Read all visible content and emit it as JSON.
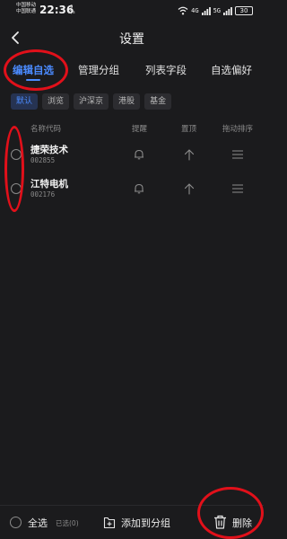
{
  "status_bar": {
    "carrier_1": "中国移动",
    "carrier_2": "中国联通",
    "time": "22:36",
    "net_speed_value": "5",
    "net_speed_unit": "K/s",
    "signal_1": "4G",
    "signal_2": "5G",
    "battery": "30"
  },
  "header": {
    "title": "设置"
  },
  "tabs": [
    {
      "label": "编辑自选",
      "active": true
    },
    {
      "label": "管理分组",
      "active": false
    },
    {
      "label": "列表字段",
      "active": false
    },
    {
      "label": "自选偏好",
      "active": false
    }
  ],
  "filters": [
    {
      "label": "默认",
      "active": true
    },
    {
      "label": "浏览",
      "active": false
    },
    {
      "label": "沪深京",
      "active": false
    },
    {
      "label": "港股",
      "active": false
    },
    {
      "label": "基金",
      "active": false
    }
  ],
  "columns": {
    "name_code": "名称代码",
    "remind": "提醒",
    "pin_top": "置顶",
    "drag_sort": "拖动排序"
  },
  "stocks": [
    {
      "name": "捷荣技术",
      "code": "002855"
    },
    {
      "name": "江特电机",
      "code": "002176"
    }
  ],
  "bottom_bar": {
    "select_all": "全选",
    "selected_count": "已选(0)",
    "add_to_group": "添加到分组",
    "delete": "删除"
  },
  "colors": {
    "accent": "#4b8bff",
    "annotation": "#e1101a",
    "background": "#1b1b1d"
  }
}
